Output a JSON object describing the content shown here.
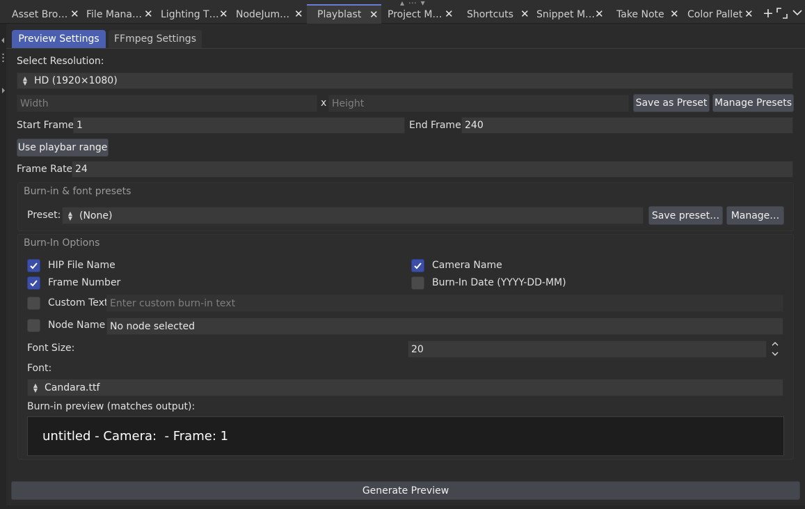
{
  "tabs": [
    {
      "label": "Asset Bro…",
      "active": false
    },
    {
      "label": "File Mana…",
      "active": false
    },
    {
      "label": "Lighting T…",
      "active": false
    },
    {
      "label": "NodeJum…",
      "active": false
    },
    {
      "label": "Playblast",
      "active": true
    },
    {
      "label": "Project M…",
      "active": false
    },
    {
      "label": "Shortcuts",
      "active": false
    },
    {
      "label": "Snippet M…",
      "active": false
    },
    {
      "label": "Take Note",
      "active": false
    },
    {
      "label": "Color Pallet",
      "active": false
    }
  ],
  "tab_controls": {
    "add": "+",
    "maximize": "⤢",
    "more": "⌄"
  },
  "subtabs": {
    "preview": "Preview Settings",
    "ffmpeg": "FFmpeg Settings"
  },
  "resolution": {
    "label": "Select Resolution:",
    "value": "HD (1920×1080)",
    "width_placeholder": "Width",
    "x": "x",
    "height_placeholder": "Height",
    "save_preset": "Save as Preset",
    "manage_presets": "Manage Presets"
  },
  "frames": {
    "start_label": "Start Frame:",
    "start_value": "1",
    "end_label": "End Frame:",
    "end_value": "240",
    "use_playbar": "Use playbar range",
    "rate_label": "Frame Rate:",
    "rate_value": "24"
  },
  "burnin_presets": {
    "title": "Burn-in & font presets",
    "preset_label": "Preset:",
    "preset_value": "(None)",
    "save": "Save preset…",
    "manage": "Manage…"
  },
  "burnin": {
    "title": "Burn-In Options",
    "hip_file": {
      "label": "HIP File Name",
      "checked": true
    },
    "camera": {
      "label": "Camera Name",
      "checked": true
    },
    "frame_number": {
      "label": "Frame Number",
      "checked": true
    },
    "date": {
      "label": "Burn-In Date (YYYY-DD-MM)",
      "checked": false
    },
    "custom": {
      "label": "Custom Text",
      "checked": false,
      "placeholder": "Enter custom burn-in text"
    },
    "node": {
      "label": "Node Name",
      "checked": false,
      "value": "No node selected"
    },
    "font_size_label": "Font Size:",
    "font_size_value": "20",
    "font_label": "Font:",
    "font_value": "Candara.ttf",
    "preview_label": "Burn-in preview (matches output):",
    "preview_text": "untitled - Camera:  - Frame: 1"
  },
  "generate": "Generate Preview",
  "colors": {
    "accent": "#4a5fb0",
    "checkbox": "#3c4fa8",
    "background": "#2b2b2b"
  }
}
